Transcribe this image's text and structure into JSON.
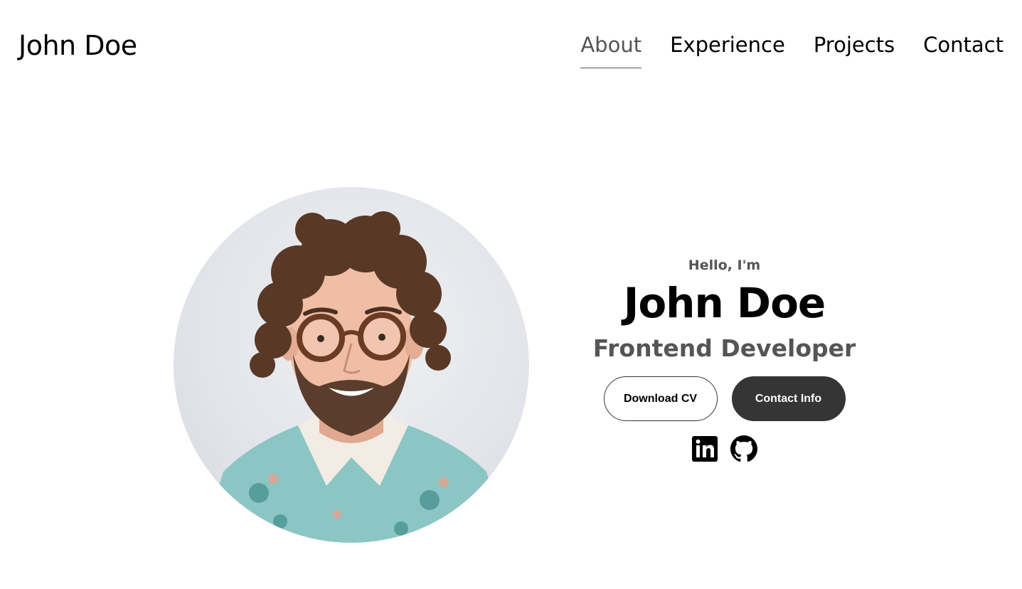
{
  "header": {
    "logo": "John Doe",
    "nav": [
      {
        "label": "About",
        "active": true
      },
      {
        "label": "Experience",
        "active": false
      },
      {
        "label": "Projects",
        "active": false
      },
      {
        "label": "Contact",
        "active": false
      }
    ]
  },
  "hero": {
    "greeting": "Hello, I'm",
    "name": "John Doe",
    "role": "Frontend Developer",
    "buttons": {
      "download_cv": "Download CV",
      "contact_info": "Contact Info"
    },
    "socials": [
      {
        "icon": "linkedin-icon"
      },
      {
        "icon": "github-icon"
      }
    ]
  },
  "colors": {
    "text": "#000000",
    "muted": "#555555",
    "button_dark": "#353535",
    "background": "#ffffff"
  }
}
